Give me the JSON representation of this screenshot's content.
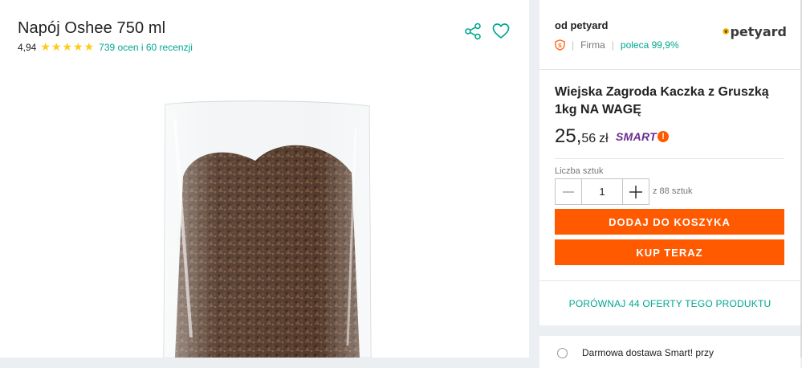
{
  "product": {
    "title": "Napój Oshee 750 ml",
    "rating": "4,94",
    "stars": 5,
    "reviews_link": "739 ocen i 60 recenzji"
  },
  "icons": {
    "share": "share-icon",
    "favorite": "heart-icon"
  },
  "seller": {
    "label": "od petyard",
    "logo_text": "petyard",
    "type": "Firma",
    "recommend": "poleca 99,9%"
  },
  "offer": {
    "title": "Wiejska Zagroda Kaczka z Gruszką 1kg NA WAGĘ",
    "price_int": "25,",
    "price_dec": "56",
    "currency": "zł",
    "smart_label": "SMART",
    "smart_mark": "!"
  },
  "quantity": {
    "label": "Liczba sztuk",
    "value": "1",
    "available": "z 88 sztuk"
  },
  "buttons": {
    "add_to_cart": "DODAJ DO KOSZYKA",
    "buy_now": "KUP TERAZ"
  },
  "compare": {
    "label": "PORÓWNAJ 44 OFERTY TEGO PRODUKTU"
  },
  "delivery": {
    "label": "Darmowa dostawa Smart! przy"
  },
  "colors": {
    "accent_orange": "#ff5a00",
    "link_teal": "#00a790",
    "star_yellow": "#ffca1b",
    "smart_purple": "#6a2c91"
  }
}
